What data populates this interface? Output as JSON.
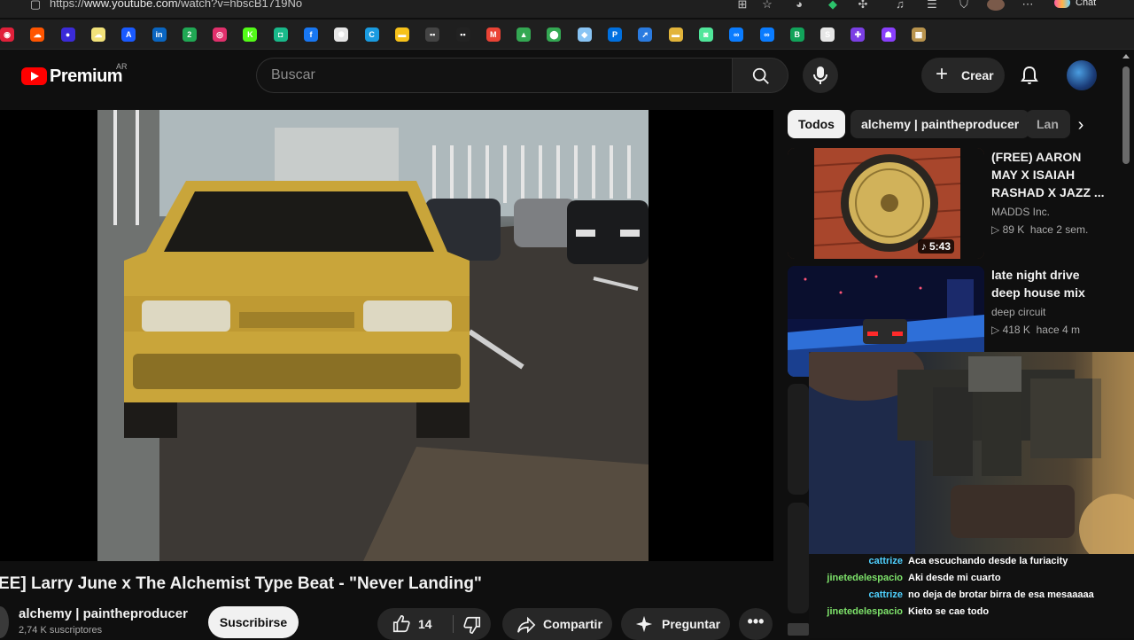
{
  "browser": {
    "url_prefix": "https://",
    "url_host": "www.youtube.com",
    "url_path": "/watch?v=hbscB1719No",
    "chat_label": "Chat",
    "bookmarks": [
      {
        "icon": "opera-icon",
        "color": "#e0203a",
        "glyph": "◉"
      },
      {
        "icon": "soundcloud-icon",
        "color": "#ff5500",
        "glyph": "☁"
      },
      {
        "icon": "circle-blue-icon",
        "color": "#3b2bd8",
        "glyph": "●"
      },
      {
        "icon": "cloud-yellow-icon",
        "color": "#f2e27a",
        "glyph": "☁"
      },
      {
        "icon": "arrow-a-icon",
        "color": "#1a5aff",
        "glyph": "A"
      },
      {
        "icon": "linkedin-icon",
        "color": "#0a66c2",
        "glyph": "in"
      },
      {
        "icon": "ext-2-icon",
        "color": "#20a854",
        "glyph": "2"
      },
      {
        "icon": "instagram-icon",
        "color": "#e1306c",
        "glyph": "◎"
      },
      {
        "icon": "kick-icon",
        "color": "#53fc18",
        "glyph": "K"
      },
      {
        "icon": "ext-green-icon",
        "color": "#19b98a",
        "glyph": "◘"
      },
      {
        "icon": "facebook-icon",
        "color": "#1877f2",
        "glyph": "f"
      },
      {
        "icon": "chatgpt-icon",
        "color": "#e6e6e6",
        "glyph": "✺"
      },
      {
        "icon": "canva-icon",
        "color": "#1a9be0",
        "glyph": "C"
      },
      {
        "icon": "wallet-icon",
        "color": "#f7c21a",
        "glyph": "▬"
      },
      {
        "icon": "dots-icon",
        "color": "#444444",
        "glyph": "▪▪"
      },
      {
        "icon": "ext-dark-icon",
        "color": "#222222",
        "glyph": "▪▪"
      },
      {
        "icon": "gmail-icon",
        "color": "#ea4335",
        "glyph": "M"
      },
      {
        "icon": "drive-icon",
        "color": "#34a853",
        "glyph": "▲"
      },
      {
        "icon": "maps-icon",
        "color": "#34a853",
        "glyph": "⬤"
      },
      {
        "icon": "fish-icon",
        "color": "#89c4f4",
        "glyph": "◆"
      },
      {
        "icon": "paypal-icon",
        "color": "#0070e0",
        "glyph": "P"
      },
      {
        "icon": "arrow-ext-icon",
        "color": "#2a7be0",
        "glyph": "➚"
      },
      {
        "icon": "note-icon",
        "color": "#e2b43a",
        "glyph": "▬"
      },
      {
        "icon": "ext-lime-icon",
        "color": "#50e69a",
        "glyph": "◙"
      },
      {
        "icon": "meta-icon",
        "color": "#0a7cff",
        "glyph": "∞"
      },
      {
        "icon": "meta-2-icon",
        "color": "#0a7cff",
        "glyph": "∞"
      },
      {
        "icon": "bing-icon",
        "color": "#12a35a",
        "glyph": "B"
      },
      {
        "icon": "spotify-icon",
        "color": "#e6e6e6",
        "glyph": "S"
      },
      {
        "icon": "ext-purple-icon",
        "color": "#7b3fe4",
        "glyph": "✚"
      },
      {
        "icon": "ext-violet-icon",
        "color": "#8a3ffc",
        "glyph": "☗"
      },
      {
        "icon": "ext-tan-icon",
        "color": "#b8934d",
        "glyph": "▦"
      }
    ]
  },
  "header": {
    "logo_text": "Premium",
    "logo_region": "AR",
    "search_placeholder": "Buscar",
    "create_label": "Crear"
  },
  "video": {
    "title": "EE] Larry June x The Alchemist Type Beat - \"Never Landing\"",
    "channel_name": "alchemy | paintheproducer",
    "channel_subs": "2,74 K suscriptores",
    "subscribe_label": "Suscribirse",
    "like_count": "14",
    "share_label": "Compartir",
    "ask_label": "Preguntar"
  },
  "chips": [
    "Todos",
    "alchemy | paintheproducer",
    "Lan"
  ],
  "recommendations": [
    {
      "title": "(FREE) AARON MAY X ISAIAH RASHAD X JAZZ ...",
      "channel": "MADDS Inc.",
      "views": "89 K",
      "age": "hace 2 sem.",
      "duration": "5:43"
    },
    {
      "title": "late night drive deep house mix",
      "channel": "deep circuit",
      "views": "418 K",
      "age": "hace 4 m"
    }
  ],
  "chat": [
    {
      "user": "cattrize",
      "color": "#4fd1ff",
      "text": "Aca escuchando desde la furiacity"
    },
    {
      "user": "jinetedelespacio",
      "color": "#7ee36b",
      "text": "Aki desde mi cuarto"
    },
    {
      "user": "cattrize",
      "color": "#4fd1ff",
      "text": "no deja de brotar birra de esa mesaaaaa"
    },
    {
      "user": "jinetedelespacio",
      "color": "#7ee36b",
      "text": "Kieto se cae todo"
    }
  ]
}
